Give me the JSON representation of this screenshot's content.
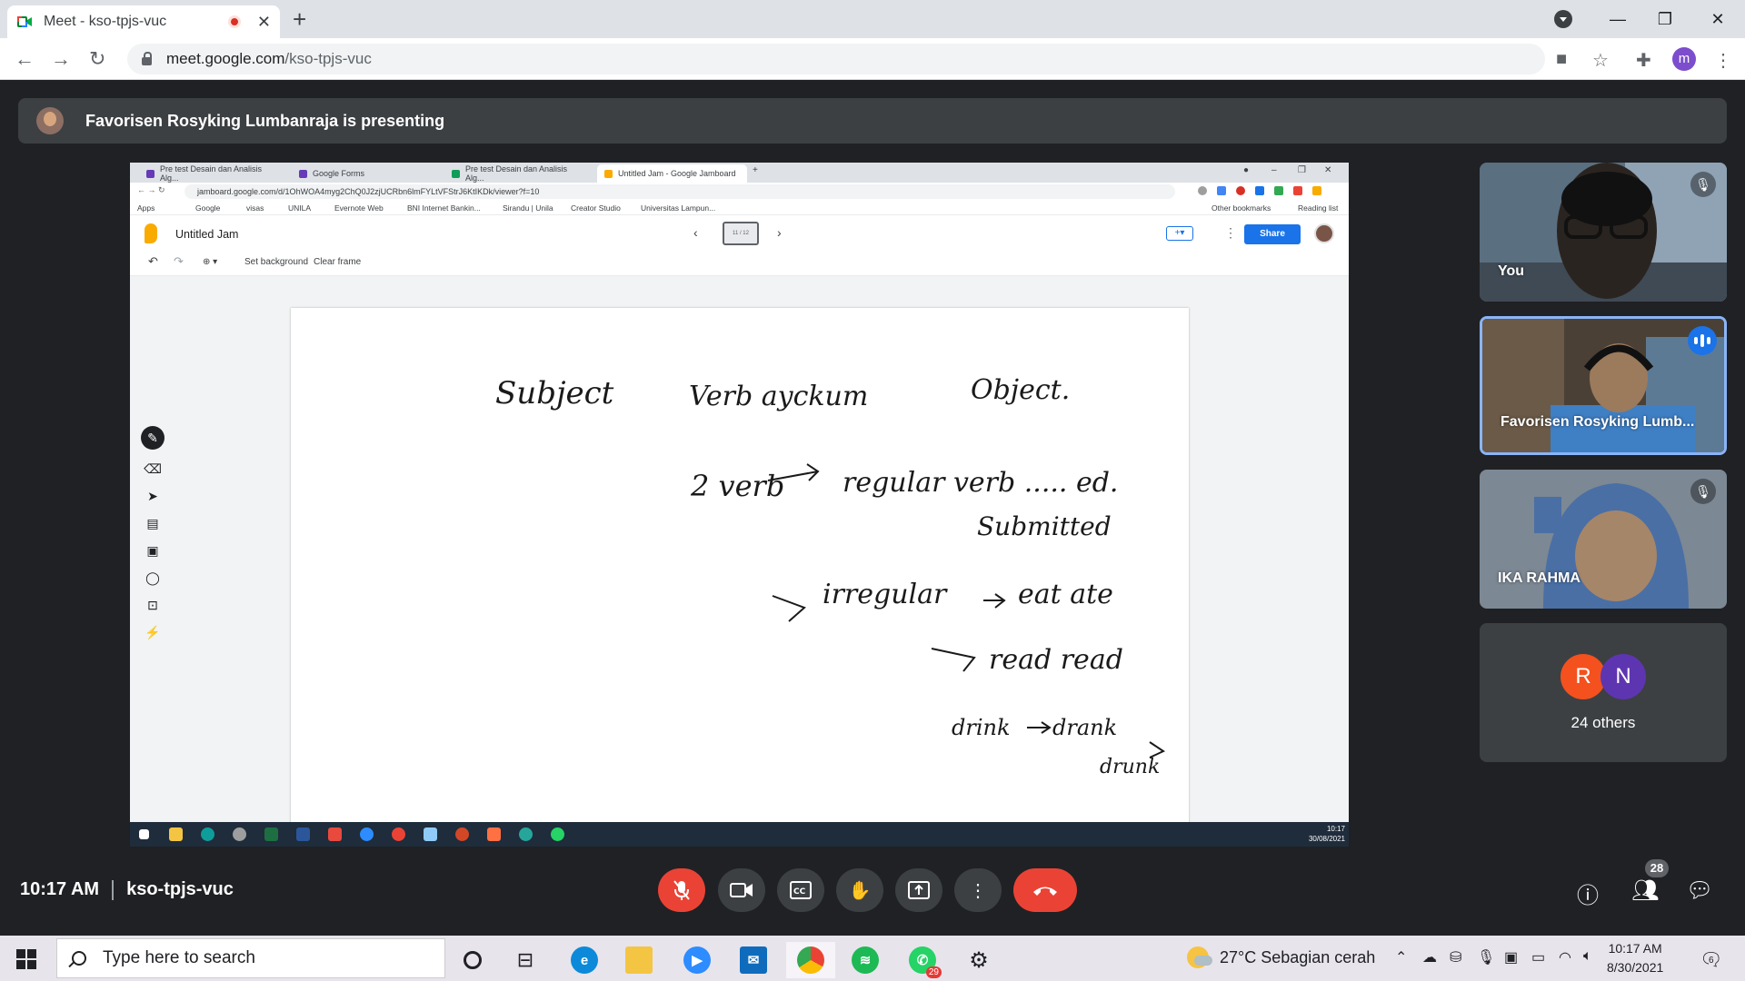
{
  "browser": {
    "tab_title": "Meet - kso-tpjs-vuc",
    "url_host": "meet.google.com",
    "url_path": "/kso-tpjs-vuc",
    "profile_initial": "m"
  },
  "meet": {
    "presenting_text": "Favorisen Rosyking Lumbanraja is presenting",
    "time": "10:17 AM",
    "meeting_code": "kso-tpjs-vuc",
    "people_count": "28",
    "tiles": [
      {
        "name": "You",
        "muted": true
      },
      {
        "name": "Favorisen Rosyking Lumb...",
        "speaking": true
      },
      {
        "name": "IKA RAHMA",
        "muted": true
      }
    ],
    "others": {
      "avatars": [
        "R",
        "N"
      ],
      "label": "24 others",
      "avatar_colors": [
        "#f4511e",
        "#5e35b1"
      ]
    }
  },
  "shared_screen": {
    "tabs": [
      "Pre test Desain dan Analisis Alg...",
      "Google Forms",
      "Pre test Desain dan Analisis Alg...",
      "Untitled Jam - Google Jamboard"
    ],
    "url": "jamboard.google.com/d/1OhWOA4myg2ChQ0J2zjUCRbn6lmFYLtVFStrJ6KtIKDk/viewer?f=10",
    "bookmarks": [
      "Apps",
      "Google",
      "visas",
      "UNILA",
      "Evernote Web",
      "BNI Internet Bankin...",
      "Sirandu | Unila",
      "Creator Studio",
      "Universitas Lampun..."
    ],
    "bookmarks_right": [
      "Other bookmarks",
      "Reading list"
    ],
    "jam_title": "Untitled Jam",
    "frame_indicator": "11 / 12",
    "share_label": "Share",
    "toolbar": {
      "set_background": "Set background",
      "clear_frame": "Clear frame"
    },
    "handwriting": [
      "Subject",
      "Verb ayckum",
      "Object.",
      "2 verb",
      "regular verb ..... ed.",
      "Submitted",
      "irregular",
      "eat ate",
      "read read",
      "drink",
      "drank",
      "drunk"
    ],
    "taskbar_time": "10:17",
    "taskbar_date": "30/08/2021"
  },
  "taskbar": {
    "search_placeholder": "Type here to search",
    "weather": "27°C  Sebagian cerah",
    "time": "10:17 AM",
    "date": "8/30/2021",
    "whatsapp_badge": "29",
    "notification_count": "6"
  }
}
